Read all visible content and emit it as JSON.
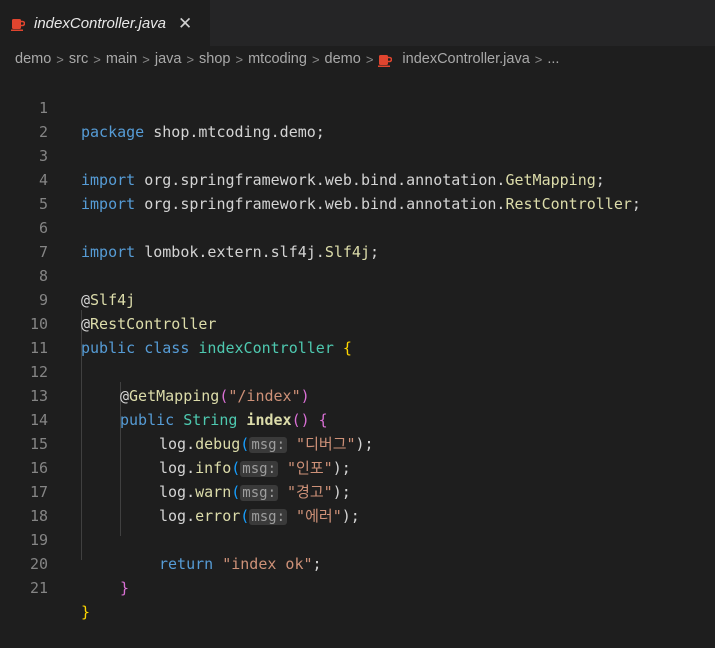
{
  "tab": {
    "title": "indexController.java",
    "close": "✕",
    "icon": "java-file-icon"
  },
  "breadcrumb": {
    "items": [
      "demo",
      "src",
      "main",
      "java",
      "shop",
      "mtcoding",
      "demo"
    ],
    "file": "indexController.java",
    "more": "..."
  },
  "colors": {
    "background": "#1e1e1e",
    "keyword": "#569cd6",
    "string": "#ce9178",
    "annotation": "#dcdcaa",
    "type": "#4ec9b0",
    "java_icon": "#e0452f"
  },
  "code": {
    "line_numbers": [
      "1",
      "2",
      "3",
      "4",
      "5",
      "6",
      "7",
      "8",
      "9",
      "10",
      "11",
      "12",
      "13",
      "14",
      "15",
      "16",
      "17",
      "18",
      "19",
      "20",
      "21"
    ],
    "l1_kw": "package",
    "l1_rest": " shop.mtcoding.demo;",
    "l3_kw": "import",
    "l3_pkg": " org.springframework.web.bind.annotation.",
    "l3_cls": "GetMapping",
    "l3_end": ";",
    "l4_kw": "import",
    "l4_pkg": " org.springframework.web.bind.annotation.",
    "l4_cls": "RestController",
    "l4_end": ";",
    "l6_kw": "import",
    "l6_pkg": " lombok.extern.slf4j.",
    "l6_cls": "Slf4j",
    "l6_end": ";",
    "l8_at": "@",
    "l8_ann": "Slf4j",
    "l9_at": "@",
    "l9_ann": "RestController",
    "l10_kw1": "public",
    "l10_kw2": " class",
    "l10_name": " indexController",
    "l10_brace": " {",
    "l12_at": "@",
    "l12_ann": "GetMapping",
    "l12_open": "(",
    "l12_str": "\"/index\"",
    "l12_close": ")",
    "l13_kw": "public",
    "l13_type": " String",
    "l13_name": " index",
    "l13_parens": "()",
    "l13_brace": " {",
    "l14_obj": "log.",
    "l14_meth": "debug",
    "l14_open": "(",
    "l14_hint": "msg:",
    "l14_str": " \"디버그\"",
    "l14_end": ");",
    "l15_obj": "log.",
    "l15_meth": "info",
    "l15_open": "(",
    "l15_hint": "msg:",
    "l15_str": " \"인포\"",
    "l15_end": ");",
    "l16_obj": "log.",
    "l16_meth": "warn",
    "l16_open": "(",
    "l16_hint": "msg:",
    "l16_str": " \"경고\"",
    "l16_end": ");",
    "l17_obj": "log.",
    "l17_meth": "error",
    "l17_open": "(",
    "l17_hint": "msg:",
    "l17_str": " \"에러\"",
    "l17_end": ");",
    "l19_kw": "return",
    "l19_str": " \"index ok\"",
    "l19_end": ";",
    "l20_brace": "}",
    "l21_brace": "}"
  }
}
